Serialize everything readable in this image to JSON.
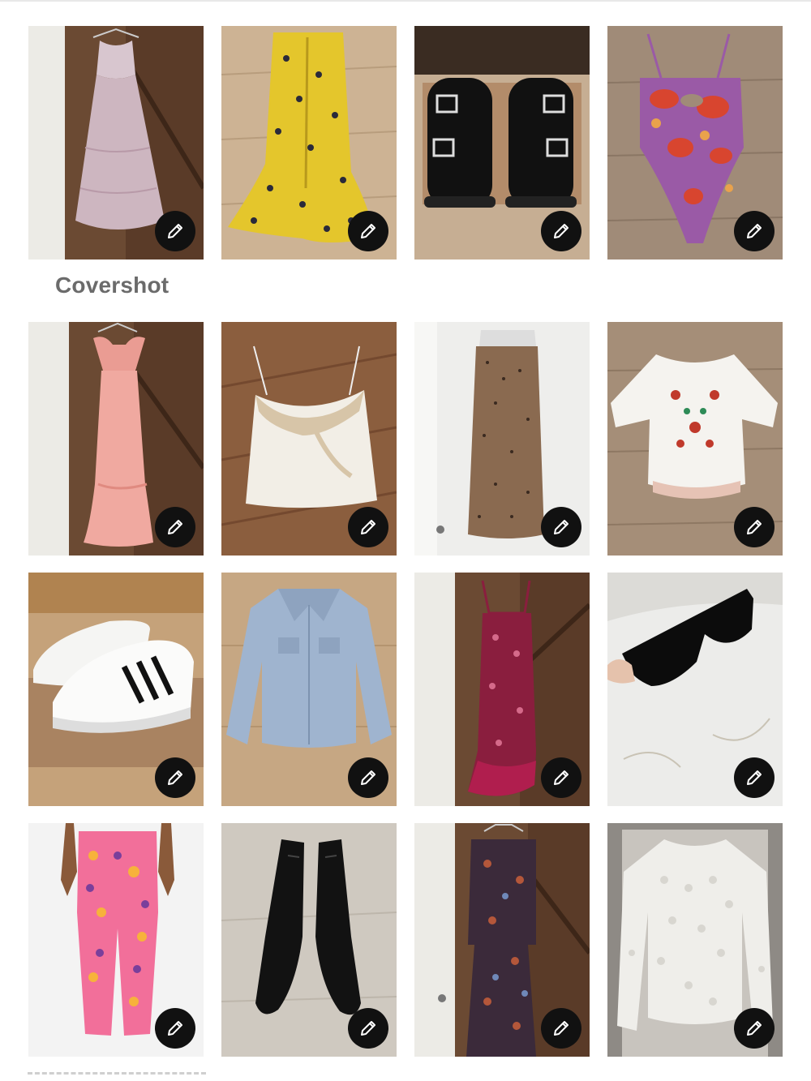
{
  "section": {
    "label": "Covershot"
  },
  "tiles": [
    {
      "item": "lavender-sundress",
      "edit_icon": "pencil-icon"
    },
    {
      "item": "yellow-floral-skirt",
      "edit_icon": "pencil-icon"
    },
    {
      "item": "black-buckle-sandals",
      "edit_icon": "pencil-icon"
    },
    {
      "item": "purple-floral-swimsuit",
      "edit_icon": "pencil-icon"
    },
    {
      "item": "pink-smocked-dress",
      "edit_icon": "pencil-icon"
    },
    {
      "item": "white-lace-camisole",
      "edit_icon": "pencil-icon"
    },
    {
      "item": "leopard-slip-skirt",
      "edit_icon": "pencil-icon"
    },
    {
      "item": "embroidered-peasant-top",
      "edit_icon": "pencil-icon"
    },
    {
      "item": "white-striped-sneakers",
      "edit_icon": "pencil-icon"
    },
    {
      "item": "denim-jacket",
      "edit_icon": "pencil-icon"
    },
    {
      "item": "red-floral-maxi-dress",
      "edit_icon": "pencil-icon"
    },
    {
      "item": "black-sunglasses",
      "edit_icon": "pencil-icon"
    },
    {
      "item": "pink-print-pants",
      "edit_icon": "pencil-icon"
    },
    {
      "item": "black-ankle-boots",
      "edit_icon": "pencil-icon"
    },
    {
      "item": "paisley-maxi-dress",
      "edit_icon": "pencil-icon"
    },
    {
      "item": "white-lace-top",
      "edit_icon": "pencil-icon"
    }
  ],
  "colors": {
    "edit_button": "#111111",
    "label": "#6b6b6b",
    "background": "#ffffff"
  }
}
